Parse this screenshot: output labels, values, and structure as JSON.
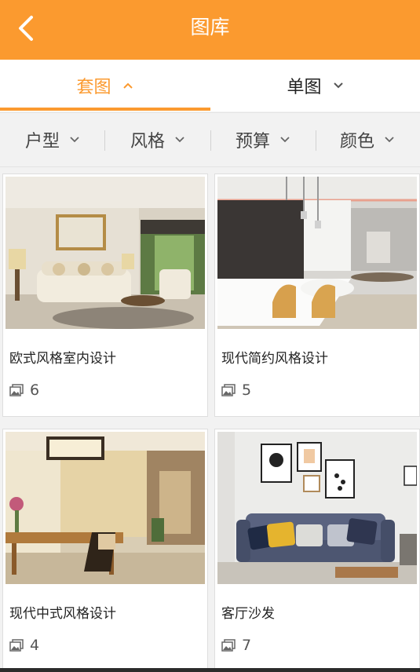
{
  "header": {
    "title": "图库"
  },
  "tabs": [
    {
      "label": "套图",
      "active": true
    },
    {
      "label": "单图",
      "active": false
    }
  ],
  "filters": [
    {
      "label": "户型"
    },
    {
      "label": "风格"
    },
    {
      "label": "预算"
    },
    {
      "label": "颜色"
    }
  ],
  "gallery": [
    {
      "caption": "欧式风格室内设计",
      "count": "6"
    },
    {
      "caption": "现代简约风格设计",
      "count": "5"
    },
    {
      "caption": "现代中式风格设计",
      "count": "4"
    },
    {
      "caption": "客厅沙发",
      "count": "7"
    }
  ],
  "colors": {
    "accent": "#fb9a2f",
    "header_text": "#ffffff"
  },
  "icons": {
    "back": "chevron-left-icon",
    "dropdown": "chevron-down-icon",
    "photos": "image-stack-icon"
  }
}
